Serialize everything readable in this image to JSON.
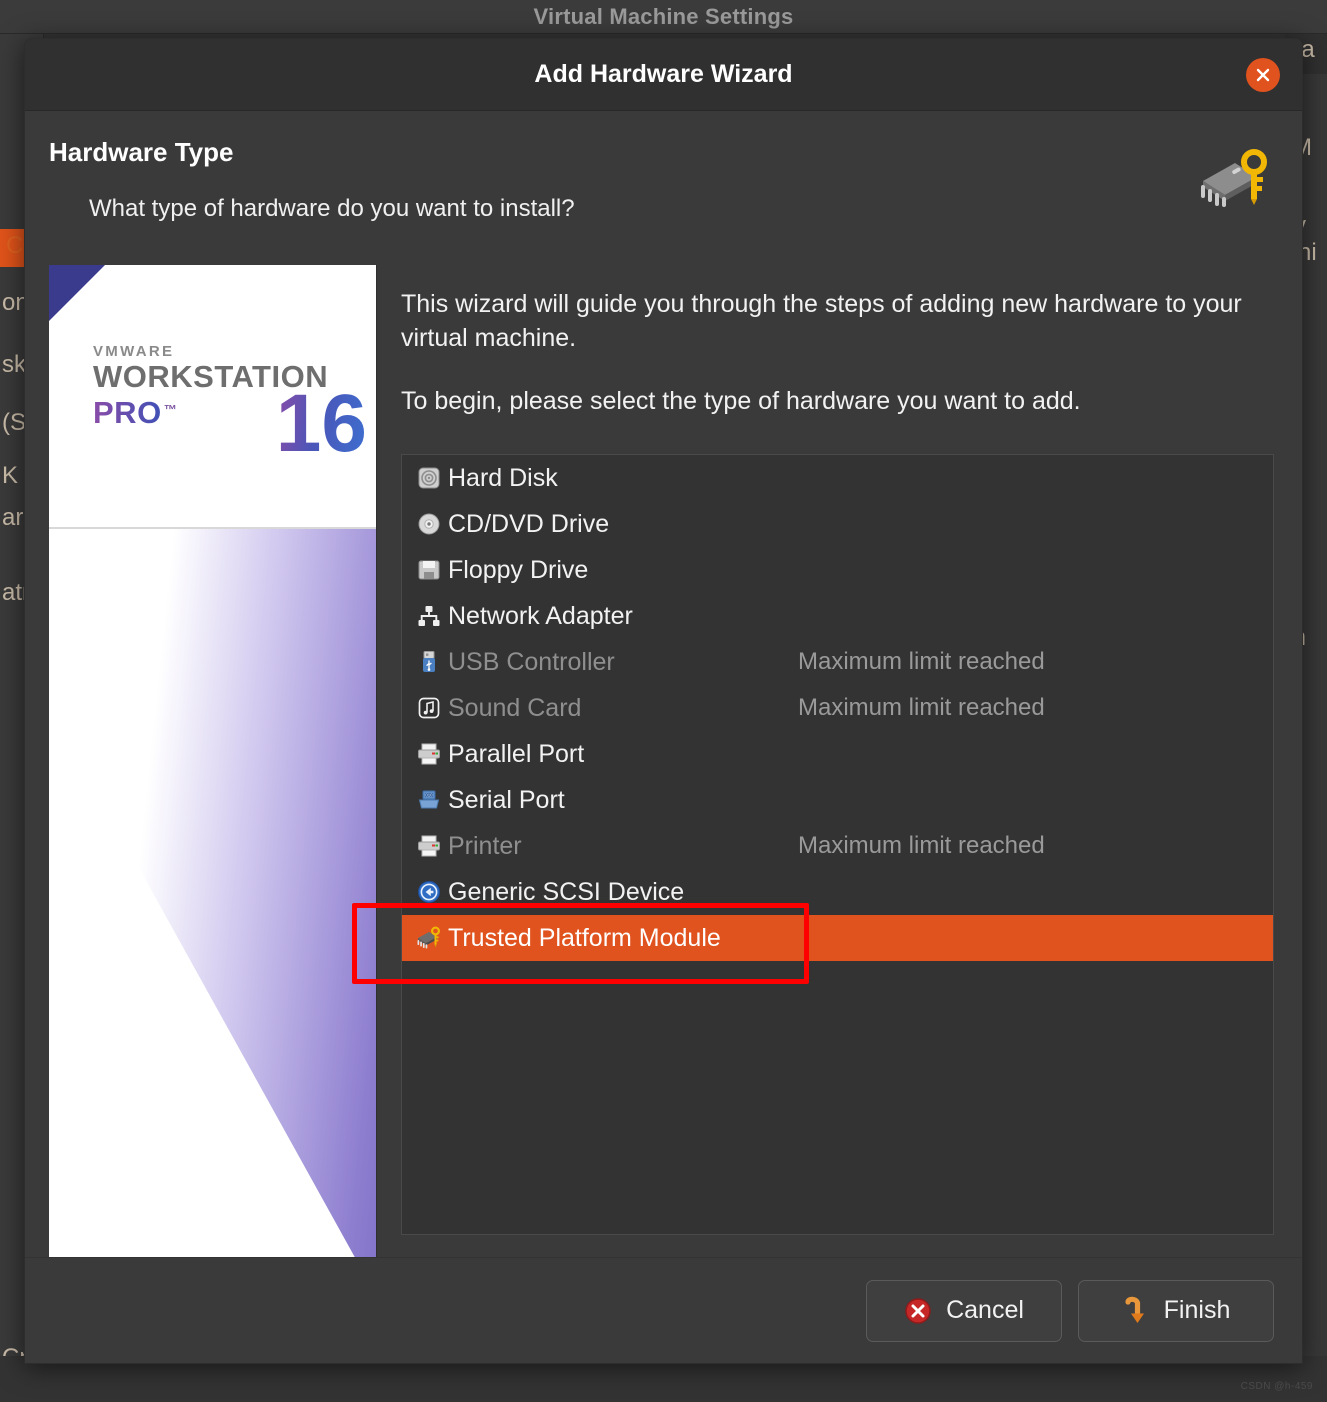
{
  "background": {
    "window_title": "Virtual Machine Settings",
    "left_fragments": [
      "on",
      "sk",
      "(S",
      "K /",
      "ar",
      "atr",
      "Cn"
    ],
    "right_fragments": [
      "na",
      "M",
      "ry",
      "chi",
      "m"
    ]
  },
  "dialog": {
    "title": "Add Hardware Wizard",
    "close_icon": "close-icon",
    "header": {
      "title": "Hardware Type",
      "subtitle": "What type of hardware do you want to install?",
      "icon": "tpm-chip-key-icon"
    },
    "splash": {
      "brand": "VMWARE",
      "product": "WORKSTATION",
      "edition": "PRO",
      "trademark": "™",
      "version": "16"
    },
    "intro": {
      "paragraph1": "This wizard will guide you through the steps of adding new hardware to your virtual machine.",
      "paragraph2": "To begin, please select the type of hardware you want to add."
    },
    "hardware_list": [
      {
        "label": "Hard Disk",
        "icon": "hard-disk-icon",
        "note": "",
        "disabled": false,
        "selected": false
      },
      {
        "label": "CD/DVD Drive",
        "icon": "cd-dvd-icon",
        "note": "",
        "disabled": false,
        "selected": false
      },
      {
        "label": "Floppy Drive",
        "icon": "floppy-icon",
        "note": "",
        "disabled": false,
        "selected": false
      },
      {
        "label": "Network Adapter",
        "icon": "network-adapter-icon",
        "note": "",
        "disabled": false,
        "selected": false
      },
      {
        "label": "USB Controller",
        "icon": "usb-icon",
        "note": "Maximum limit reached",
        "disabled": true,
        "selected": false
      },
      {
        "label": "Sound Card",
        "icon": "sound-card-icon",
        "note": "Maximum limit reached",
        "disabled": true,
        "selected": false
      },
      {
        "label": "Parallel Port",
        "icon": "parallel-port-icon",
        "note": "",
        "disabled": false,
        "selected": false
      },
      {
        "label": "Serial Port",
        "icon": "serial-port-icon",
        "note": "",
        "disabled": false,
        "selected": false
      },
      {
        "label": "Printer",
        "icon": "printer-icon",
        "note": "Maximum limit reached",
        "disabled": true,
        "selected": false
      },
      {
        "label": "Generic SCSI Device",
        "icon": "scsi-device-icon",
        "note": "",
        "disabled": false,
        "selected": false
      },
      {
        "label": "Trusted Platform Module",
        "icon": "tpm-chip-key-icon",
        "note": "",
        "disabled": false,
        "selected": true
      }
    ],
    "footer": {
      "cancel_label": "Cancel",
      "cancel_icon": "cancel-circle-icon",
      "finish_label": "Finish",
      "finish_icon": "finish-arrow-icon"
    }
  },
  "annotation": {
    "color": "#fe0000",
    "target": "Trusted Platform Module"
  },
  "watermark": "CSDN @h-459"
}
